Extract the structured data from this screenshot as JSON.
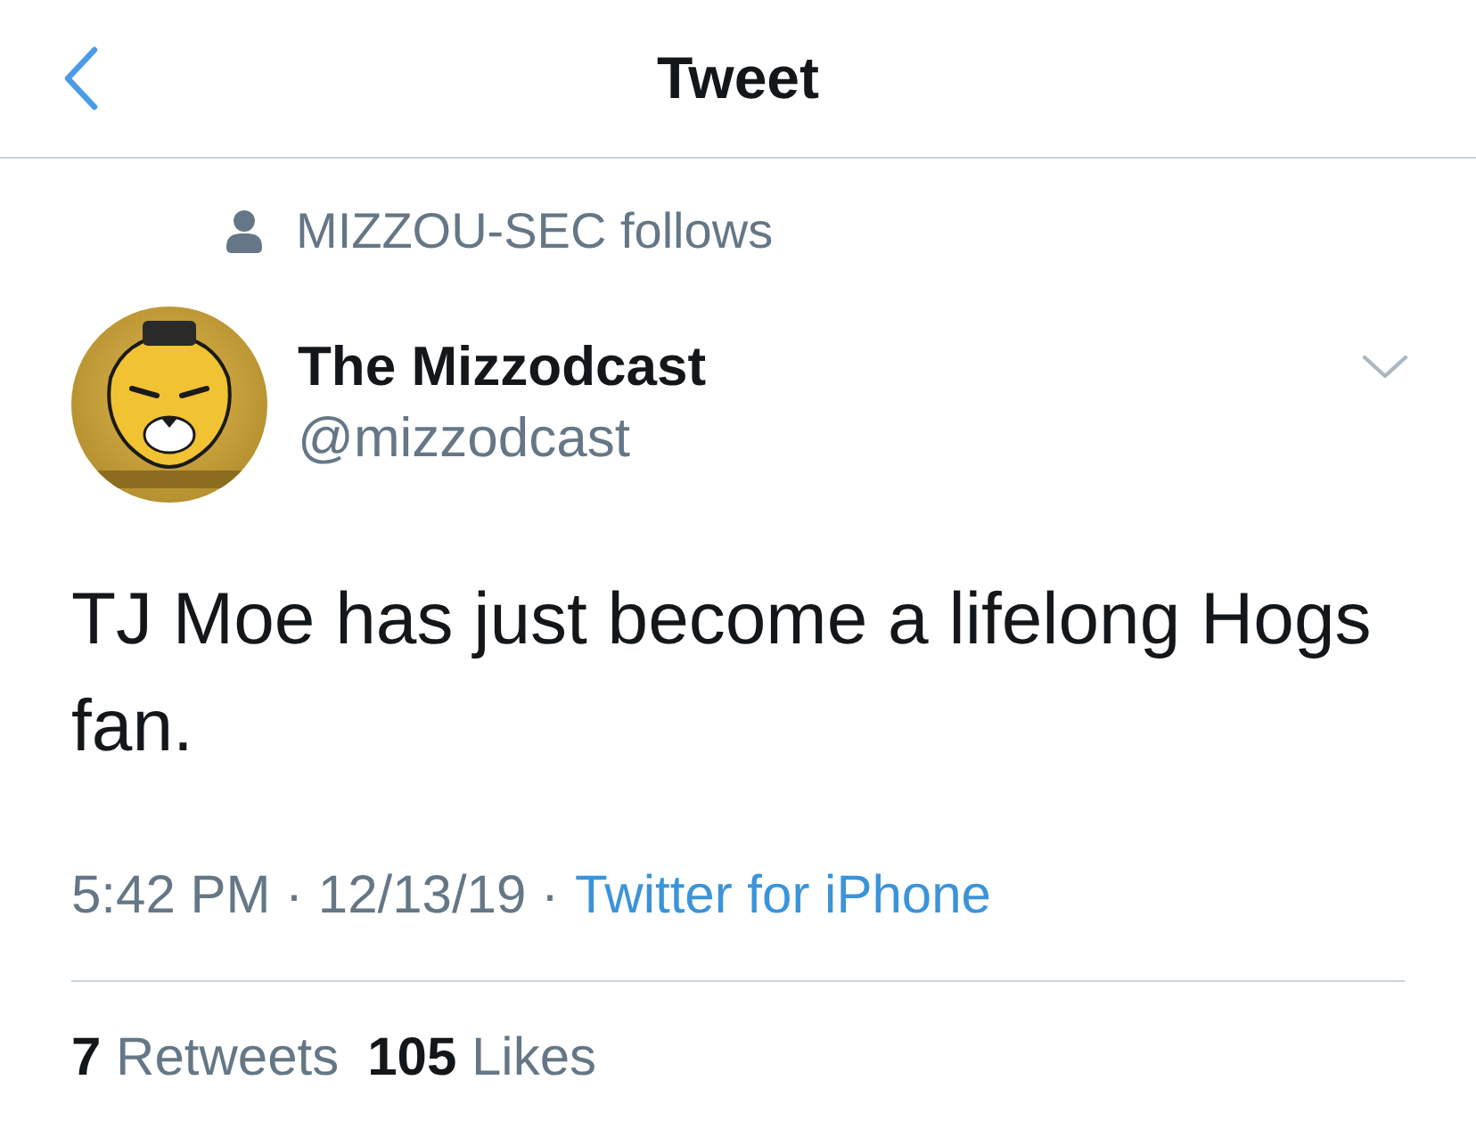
{
  "header": {
    "title": "Tweet"
  },
  "social_context": {
    "text": "MIZZOU-SEC follows"
  },
  "author": {
    "name": "The Mizzodcast",
    "handle": "@mizzodcast"
  },
  "tweet": {
    "text": "TJ Moe has just become a lifelong Hogs fan."
  },
  "meta": {
    "timestamp": "5:42 PM · 12/13/19 ·",
    "source": "Twitter for iPhone"
  },
  "stats": [
    {
      "count": "7",
      "label": "Retweets"
    },
    {
      "count": "105",
      "label": "Likes"
    }
  ]
}
